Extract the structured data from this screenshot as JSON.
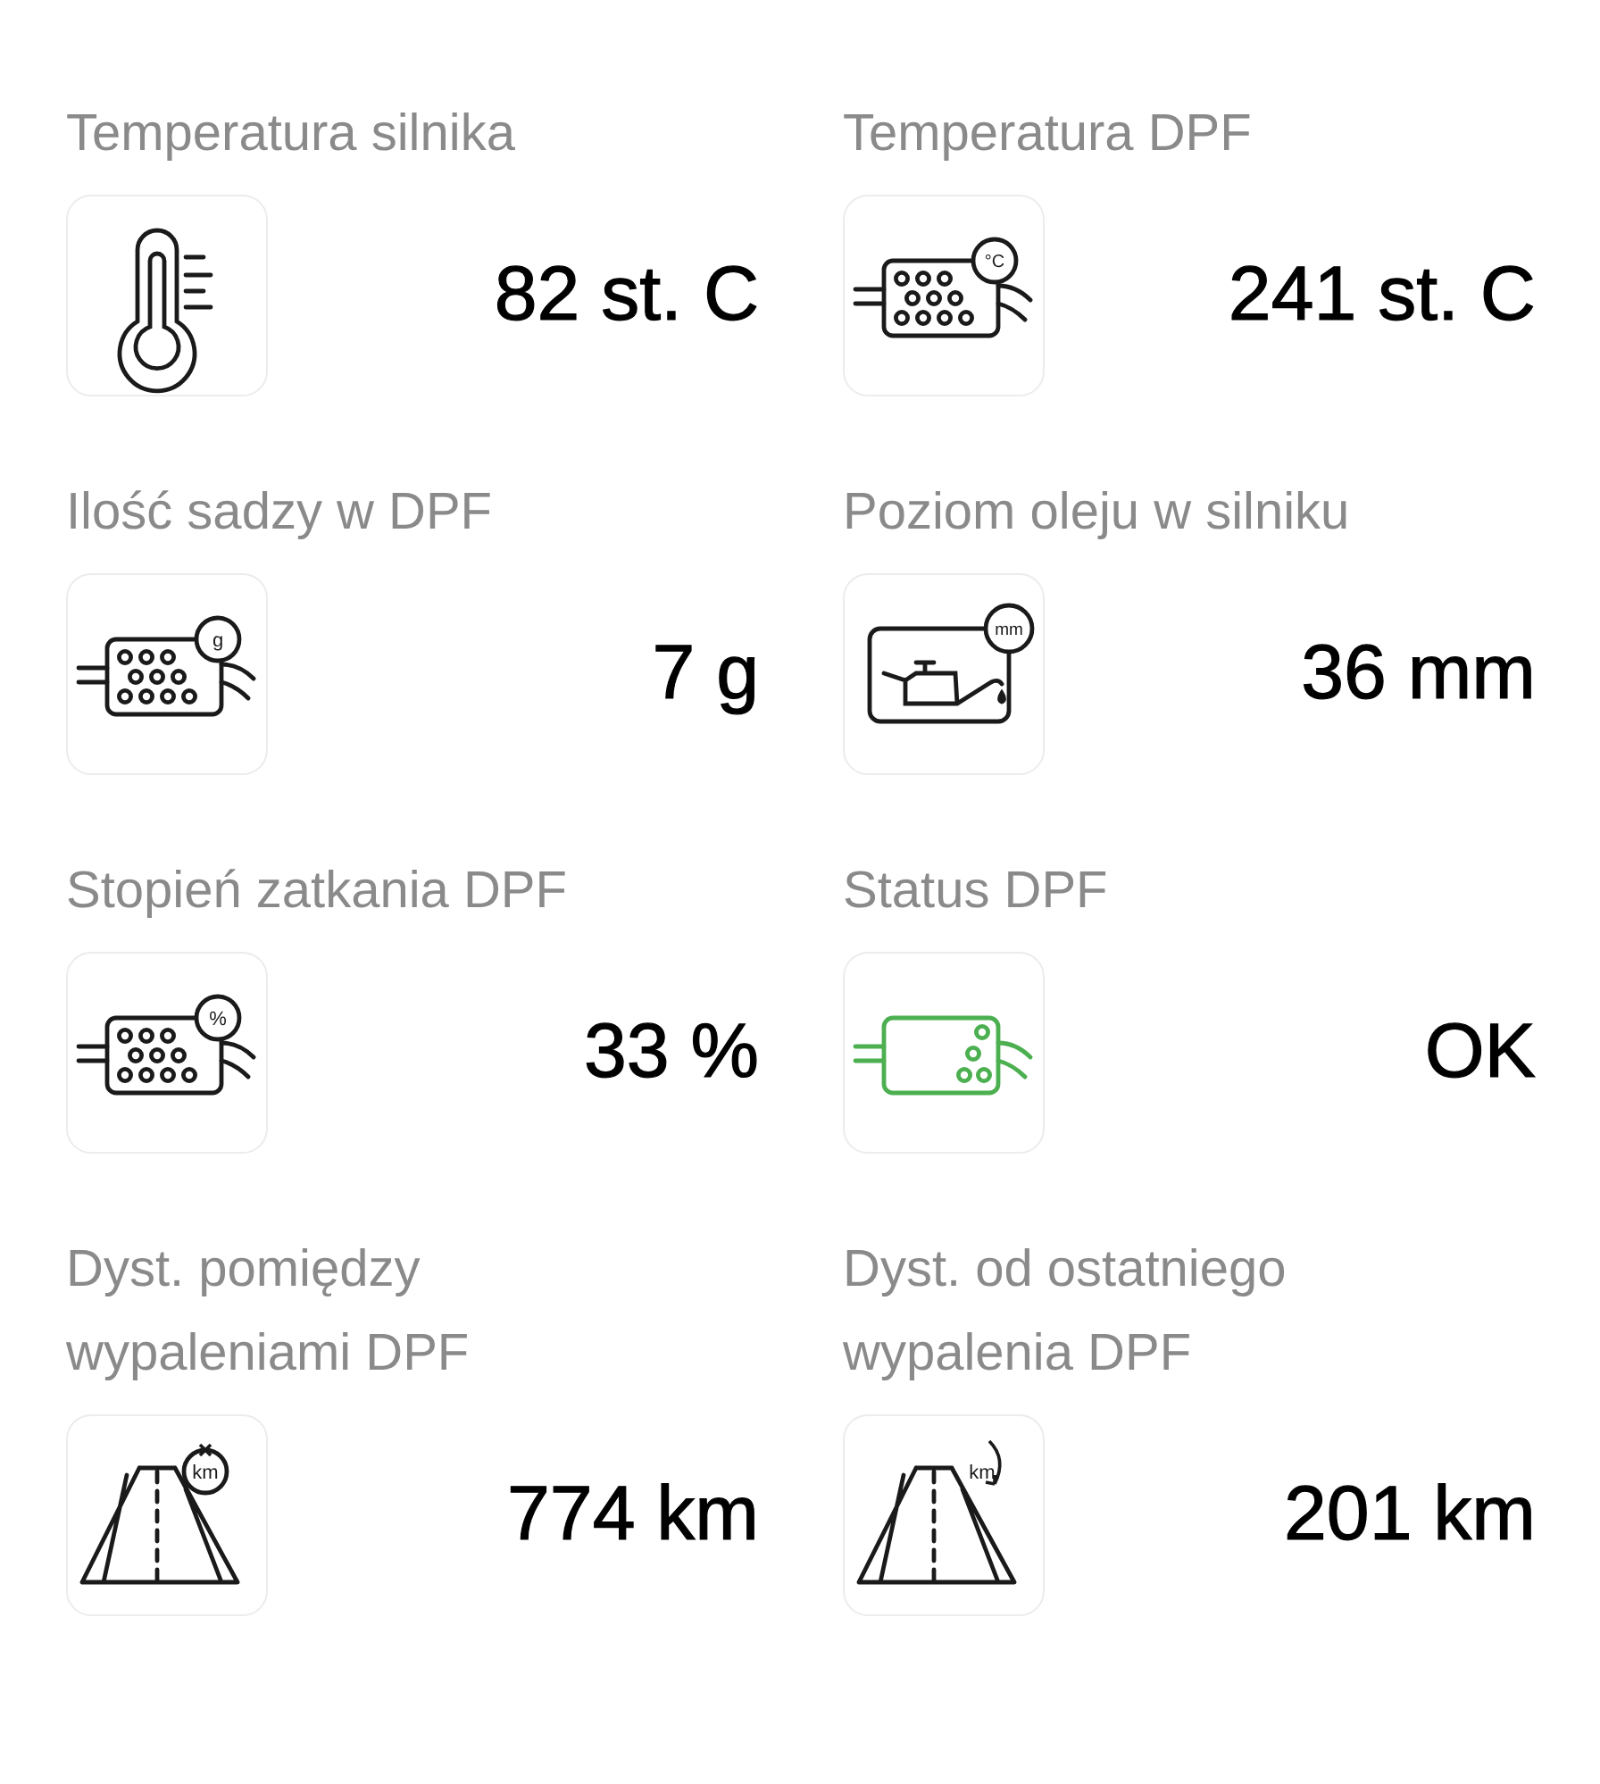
{
  "tiles": [
    {
      "label": "Temperatura silnika",
      "value": "82 st. C",
      "icon": {
        "kind": "thermometer",
        "color": "#1a1a1a"
      }
    },
    {
      "label": "Temperatura DPF",
      "value": "241 st. C",
      "icon": {
        "kind": "filter",
        "badge": "°C",
        "color": "#1a1a1a"
      }
    },
    {
      "label": "Ilość sadzy w DPF",
      "value": "7 g",
      "icon": {
        "kind": "filter",
        "badge": "g",
        "color": "#1a1a1a"
      }
    },
    {
      "label": "Poziom oleju w silniku",
      "value": "36 mm",
      "icon": {
        "kind": "oil",
        "badge": "mm",
        "color": "#1a1a1a"
      }
    },
    {
      "label": "Stopień zatkania DPF",
      "value": "33 %",
      "icon": {
        "kind": "filter",
        "badge": "%",
        "color": "#1a1a1a"
      }
    },
    {
      "label": "Status DPF",
      "value": "OK",
      "icon": {
        "kind": "filter-clean",
        "color": "#4caf50"
      }
    },
    {
      "label": "Dyst. pomiędzy\nwypaleniami DPF",
      "value": "774 km",
      "icon": {
        "kind": "road",
        "badge": "km",
        "color": "#1a1a1a"
      }
    },
    {
      "label": "Dyst. od ostatniego\nwypalenia DPF",
      "value": "201 km",
      "icon": {
        "kind": "road-loop",
        "badge": "km",
        "color": "#1a1a1a"
      }
    }
  ]
}
